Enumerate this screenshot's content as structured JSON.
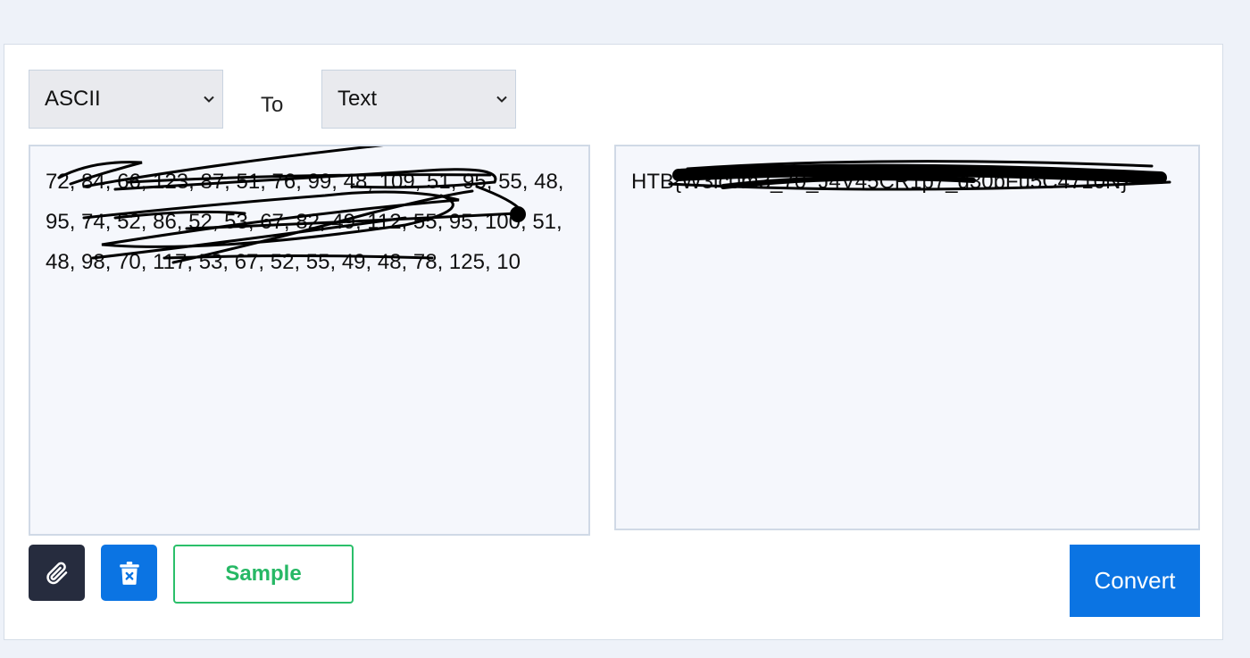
{
  "converter": {
    "from_select": {
      "selected": "ASCII",
      "icon": "chevron-down-icon"
    },
    "to_label": "To",
    "to_select": {
      "selected": "Text",
      "icon": "chevron-down-icon"
    },
    "input_text": "72, 84, 66, 123, 87, 51, 76, 99, 48, 109, 51, 95, 55, 48, 95, 74, 52, 86, 52, 53, 67, 82, 49, 112, 55, 95, 100, 51, 48, 98, 70, 117, 53, 67, 52, 55, 49, 48, 78, 125, 10",
    "output_text": "HTB{W3lc0m3_70_J4V45CR1p7_d30bFu5C4710N}"
  },
  "actions": {
    "attach_icon": "paperclip-icon",
    "clear_icon": "trash-x-icon",
    "sample_label": "Sample",
    "convert_label": "Convert"
  },
  "colors": {
    "page_background": "#eef2f9",
    "primary": "#0b74e3",
    "dark_button": "#262c3e",
    "sample_green": "#27b865"
  }
}
